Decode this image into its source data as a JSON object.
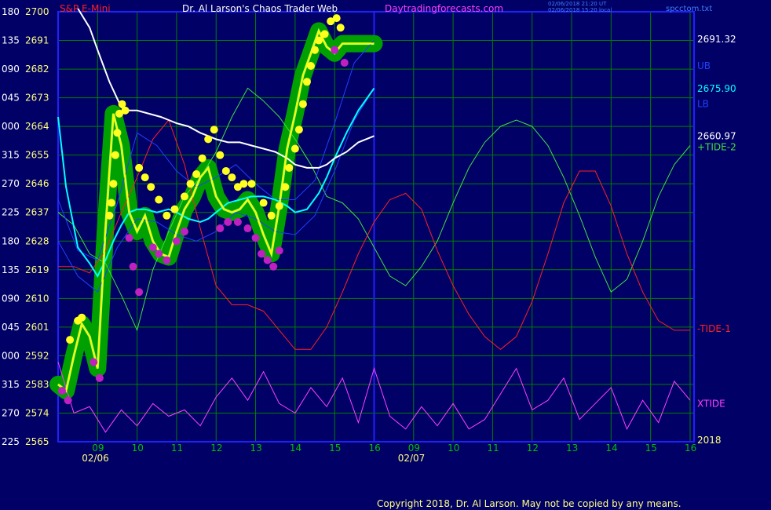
{
  "header": {
    "symbol": "S&P E-Mini",
    "title": "Dr. Al Larson's Chaos Trader Web",
    "site": "Daytradingforecasts.com",
    "stamp1": "02/06/2018 21:20 UT",
    "stamp2": "02/06/2018 15:20 local",
    "file": "spcctom.txt"
  },
  "footer": {
    "copyright": "Copyright 2018, Dr. Al Larson. May not be copied by any means."
  },
  "colors": {
    "background": "#000066",
    "grid": "#008000",
    "border": "#2020ff",
    "price_label": "#ffff80",
    "angle_label": "#ffffff",
    "hour_label": "#00c000",
    "symbol": "#ff2020",
    "title": "#ffffff",
    "site": "#ff40ff",
    "stamp": "#4080ff",
    "tide1": "#ff2020",
    "tide2": "#40e040",
    "xtide": "#ff40ff",
    "ub_lb": "#2040ff",
    "cyan_avg": "#00ffff",
    "white_avg": "#ffffff",
    "price_band": "#00a000",
    "price_line": "#ffff00"
  },
  "chart_data": {
    "type": "line",
    "ylim": [
      2565,
      2700
    ],
    "y_ticks": [
      {
        "angle": "180",
        "price": 2700
      },
      {
        "angle": "135",
        "price": 2691
      },
      {
        "angle": "090",
        "price": 2682
      },
      {
        "angle": "045",
        "price": 2673
      },
      {
        "angle": "000",
        "price": 2664
      },
      {
        "angle": "315",
        "price": 2655
      },
      {
        "angle": "270",
        "price": 2646
      },
      {
        "angle": "225",
        "price": 2637
      },
      {
        "angle": "180",
        "price": 2628
      },
      {
        "angle": "135",
        "price": 2619
      },
      {
        "angle": "090",
        "price": 2610
      },
      {
        "angle": "045",
        "price": 2601
      },
      {
        "angle": "000",
        "price": 2592
      },
      {
        "angle": "315",
        "price": 2583
      },
      {
        "angle": "270",
        "price": 2574
      },
      {
        "angle": "225",
        "price": 2565
      }
    ],
    "x_hour_labels": [
      {
        "label": "09",
        "x": 9.0
      },
      {
        "label": "10",
        "x": 10.0
      },
      {
        "label": "11",
        "x": 11.0
      },
      {
        "label": "12",
        "x": 12.0
      },
      {
        "label": "13",
        "x": 13.0
      },
      {
        "label": "14",
        "x": 14.0
      },
      {
        "label": "15",
        "x": 15.0
      },
      {
        "label": "16",
        "x": 16.0
      },
      {
        "label": "09",
        "x": 17.0
      },
      {
        "label": "10",
        "x": 18.0
      },
      {
        "label": "11",
        "x": 19.0
      },
      {
        "label": "12",
        "x": 20.0
      },
      {
        "label": "13",
        "x": 21.0
      },
      {
        "label": "14",
        "x": 22.0
      },
      {
        "label": "15",
        "x": 23.0
      },
      {
        "label": "16",
        "x": 24.0
      }
    ],
    "x_day_labels": [
      {
        "label": "02/06",
        "x": 8.8
      },
      {
        "label": "02/07",
        "x": 16.8
      }
    ],
    "xlim": [
      8.0,
      24.1
    ],
    "right_labels": [
      {
        "text": "2691.32",
        "price": 2691.32,
        "color": "#ffffff"
      },
      {
        "text": "UB",
        "price": 2683.0,
        "color": "#2040ff"
      },
      {
        "text": "2675.90",
        "price": 2675.9,
        "color": "#00ffff"
      },
      {
        "text": "LB",
        "price": 2671.0,
        "color": "#2040ff"
      },
      {
        "text": "2660.97",
        "price": 2660.97,
        "color": "#ffffff"
      },
      {
        "text": "+TIDE-2",
        "price": 2657.5,
        "color": "#40e040"
      },
      {
        "text": "-TIDE-1",
        "price": 2600.5,
        "color": "#ff2020"
      },
      {
        "text": "XTIDE",
        "price": 2577.0,
        "color": "#ff40ff"
      },
      {
        "text": "2018",
        "price": 2565.5,
        "color": "#ffff80"
      }
    ],
    "series": [
      {
        "name": "S&P E-Mini",
        "color": "#ffff00",
        "x": [
          8.0,
          8.2,
          8.4,
          8.6,
          8.8,
          9.0,
          9.2,
          9.4,
          9.6,
          9.8,
          10.0,
          10.2,
          10.4,
          10.6,
          10.8,
          11.0,
          11.2,
          11.4,
          11.6,
          11.8,
          12.0,
          12.2,
          12.4,
          12.6,
          12.8,
          13.0,
          13.2,
          13.4,
          13.6,
          13.8,
          14.0,
          14.2,
          14.4,
          14.6,
          14.8,
          15.0,
          15.2,
          15.4,
          15.6,
          15.8,
          16.0
        ],
        "y": [
          2583,
          2581,
          2592,
          2602,
          2598,
          2588,
          2632,
          2668,
          2658,
          2637,
          2631,
          2636,
          2628,
          2624,
          2623,
          2631,
          2638,
          2642,
          2648,
          2651,
          2642,
          2638,
          2637,
          2638,
          2641,
          2637,
          2630,
          2624,
          2639,
          2657,
          2668,
          2680,
          2687,
          2694,
          2689,
          2687,
          2690,
          2690,
          2690,
          2690,
          2690
        ]
      },
      {
        "name": "+TIDE-2",
        "color": "#40e040",
        "x": [
          8.0,
          8.4,
          8.8,
          9.2,
          9.6,
          10.0,
          10.4,
          10.8,
          11.2,
          11.6,
          12.0,
          12.4,
          12.8,
          13.2,
          13.6,
          14.0,
          14.4,
          14.8,
          15.2,
          15.6,
          16.0,
          16.4,
          16.8,
          17.2,
          17.6,
          18.0,
          18.4,
          18.8,
          19.2,
          19.6,
          20.0,
          20.4,
          20.8,
          21.2,
          21.6,
          22.0,
          22.4,
          22.8,
          23.2,
          23.6,
          24.0
        ],
        "y": [
          2637,
          2633,
          2624,
          2621,
          2611,
          2600,
          2619,
          2631,
          2642,
          2648,
          2656,
          2667,
          2676,
          2672,
          2667,
          2660,
          2652,
          2642,
          2640,
          2635,
          2626,
          2617,
          2614,
          2620,
          2628,
          2640,
          2651,
          2659,
          2664,
          2666,
          2664,
          2658,
          2648,
          2636,
          2623,
          2612,
          2616,
          2628,
          2642,
          2652,
          2658
        ]
      },
      {
        "name": "-TIDE-1",
        "color": "#ff2020",
        "x": [
          8.0,
          8.4,
          8.8,
          9.2,
          9.6,
          10.0,
          10.4,
          10.8,
          11.2,
          11.6,
          12.0,
          12.4,
          12.8,
          13.2,
          13.6,
          14.0,
          14.4,
          14.8,
          15.2,
          15.6,
          16.0,
          16.4,
          16.8,
          17.2,
          17.6,
          18.0,
          18.4,
          18.8,
          19.2,
          19.6,
          20.0,
          20.4,
          20.8,
          21.2,
          21.6,
          22.0,
          22.4,
          22.8,
          23.2,
          23.6,
          24.0
        ],
        "y": [
          2620,
          2620,
          2618,
          2625,
          2637,
          2648,
          2660,
          2666,
          2652,
          2632,
          2614,
          2608,
          2608,
          2606,
          2600,
          2594,
          2594,
          2601,
          2612,
          2624,
          2634,
          2641,
          2643,
          2638,
          2625,
          2614,
          2605,
          2598,
          2594,
          2598,
          2609,
          2624,
          2640,
          2650,
          2650,
          2639,
          2624,
          2612,
          2603,
          2600,
          2600
        ]
      },
      {
        "name": "XTIDE",
        "color": "#ff40ff",
        "x": [
          8.0,
          8.4,
          8.8,
          9.2,
          9.6,
          10.0,
          10.4,
          10.8,
          11.2,
          11.6,
          12.0,
          12.4,
          12.8,
          13.2,
          13.6,
          14.0,
          14.4,
          14.8,
          15.2,
          15.6,
          16.0,
          16.4,
          16.8,
          17.2,
          17.6,
          18.0,
          18.4,
          18.8,
          19.2,
          19.6,
          20.0,
          20.4,
          20.8,
          21.2,
          21.6,
          22.0,
          22.4,
          22.8,
          23.2,
          23.6,
          24.0
        ],
        "y": [
          2590,
          2574,
          2576,
          2568,
          2575,
          2570,
          2577,
          2573,
          2575,
          2570,
          2579,
          2585,
          2578,
          2587,
          2577,
          2574,
          2582,
          2576,
          2585,
          2571,
          2588,
          2573,
          2569,
          2576,
          2570,
          2577,
          2569,
          2572,
          2580,
          2588,
          2575,
          2578,
          2585,
          2572,
          2577,
          2582,
          2569,
          2578,
          2571,
          2584,
          2578
        ]
      },
      {
        "name": "UB",
        "color": "#2040ff",
        "x": [
          8.0,
          8.5,
          9.0,
          9.5,
          10.0,
          10.5,
          11.0,
          11.5,
          12.0,
          12.5,
          13.0,
          13.5,
          14.0,
          14.5,
          15.0,
          15.5,
          16.0
        ],
        "y": [
          2641,
          2625,
          2622,
          2640,
          2662,
          2658,
          2650,
          2645,
          2648,
          2652,
          2646,
          2641,
          2641,
          2647,
          2665,
          2684,
          2691
        ]
      },
      {
        "name": "LB",
        "color": "#2040ff",
        "x": [
          8.0,
          8.5,
          9.0,
          9.5,
          10.0,
          10.5,
          11.0,
          11.5,
          12.0,
          12.5,
          13.0,
          13.5,
          14.0,
          14.5,
          15.0,
          15.5,
          16.0
        ],
        "y": [
          2628,
          2617,
          2612,
          2626,
          2635,
          2634,
          2630,
          2628,
          2631,
          2637,
          2635,
          2631,
          2630,
          2636,
          2650,
          2666,
          2676
        ]
      },
      {
        "name": "cyan",
        "color": "#00ffff",
        "x": [
          8.0,
          8.2,
          8.5,
          8.8,
          9.0,
          9.2,
          9.4,
          9.6,
          9.8,
          10.0,
          10.2,
          10.5,
          10.8,
          11.0,
          11.3,
          11.6,
          11.8,
          12.0,
          12.3,
          12.6,
          12.9,
          13.2,
          13.5,
          13.8,
          14.0,
          14.3,
          14.6,
          14.8,
          15.0,
          15.3,
          15.6,
          16.0
        ],
        "y": [
          2667,
          2645,
          2626,
          2621,
          2617,
          2622,
          2628,
          2633,
          2637,
          2638,
          2638,
          2637,
          2638,
          2637,
          2635,
          2634,
          2635,
          2637,
          2640,
          2641,
          2642,
          2642,
          2641,
          2639,
          2637,
          2638,
          2643,
          2648,
          2654,
          2662,
          2669,
          2676
        ]
      },
      {
        "name": "white",
        "color": "#ffffff",
        "x": [
          8.5,
          8.8,
          9.0,
          9.3,
          9.6,
          9.8,
          10.0,
          10.3,
          10.6,
          10.8,
          11.0,
          11.3,
          11.6,
          11.8,
          12.0,
          12.3,
          12.6,
          12.9,
          13.2,
          13.5,
          13.8,
          14.0,
          14.3,
          14.6,
          14.8,
          15.0,
          15.3,
          15.6,
          16.0
        ],
        "y": [
          2701,
          2695,
          2688,
          2678,
          2670,
          2669,
          2669,
          2668,
          2667,
          2666,
          2665,
          2664,
          2662,
          2661,
          2660,
          2659,
          2659,
          2658,
          2657,
          2656,
          2654,
          2652,
          2651,
          2651,
          2652,
          2654,
          2656,
          2659,
          2661
        ]
      }
    ],
    "markers": {
      "yellow": [
        [
          8.3,
          2597
        ],
        [
          8.5,
          2603
        ],
        [
          8.6,
          2604
        ],
        [
          9.55,
          2668
        ],
        [
          9.7,
          2669
        ],
        [
          9.62,
          2671
        ],
        [
          9.5,
          2662
        ],
        [
          9.45,
          2655
        ],
        [
          9.4,
          2646
        ],
        [
          9.35,
          2640
        ],
        [
          9.3,
          2636
        ],
        [
          10.05,
          2651
        ],
        [
          10.2,
          2648
        ],
        [
          10.35,
          2645
        ],
        [
          10.55,
          2641
        ],
        [
          10.75,
          2636
        ],
        [
          10.95,
          2638
        ],
        [
          11.2,
          2642
        ],
        [
          11.35,
          2646
        ],
        [
          11.5,
          2649
        ],
        [
          11.65,
          2654
        ],
        [
          11.8,
          2660
        ],
        [
          11.95,
          2663
        ],
        [
          12.1,
          2655
        ],
        [
          12.25,
          2650
        ],
        [
          12.4,
          2648
        ],
        [
          12.55,
          2645
        ],
        [
          12.7,
          2646
        ],
        [
          12.9,
          2646
        ],
        [
          13.2,
          2640
        ],
        [
          13.4,
          2636
        ],
        [
          13.6,
          2639
        ],
        [
          13.75,
          2645
        ],
        [
          13.85,
          2651
        ],
        [
          14.0,
          2657
        ],
        [
          14.1,
          2663
        ],
        [
          14.2,
          2671
        ],
        [
          14.3,
          2678
        ],
        [
          14.4,
          2683
        ],
        [
          14.5,
          2688
        ],
        [
          14.6,
          2691
        ],
        [
          14.75,
          2693
        ],
        [
          14.9,
          2697
        ],
        [
          15.05,
          2698
        ],
        [
          15.15,
          2695
        ]
      ],
      "magenta": [
        [
          8.1,
          2581
        ],
        [
          8.25,
          2578
        ],
        [
          8.9,
          2590
        ],
        [
          9.05,
          2585
        ],
        [
          9.8,
          2629
        ],
        [
          9.9,
          2620
        ],
        [
          10.05,
          2612
        ],
        [
          10.4,
          2626
        ],
        [
          10.55,
          2624
        ],
        [
          10.75,
          2622
        ],
        [
          11.0,
          2628
        ],
        [
          11.2,
          2631
        ],
        [
          12.1,
          2632
        ],
        [
          12.3,
          2634
        ],
        [
          12.55,
          2634
        ],
        [
          12.8,
          2632
        ],
        [
          13.0,
          2629
        ],
        [
          13.15,
          2624
        ],
        [
          13.3,
          2622
        ],
        [
          13.45,
          2620
        ],
        [
          13.6,
          2625
        ],
        [
          15.0,
          2688
        ],
        [
          15.25,
          2684
        ]
      ]
    }
  }
}
